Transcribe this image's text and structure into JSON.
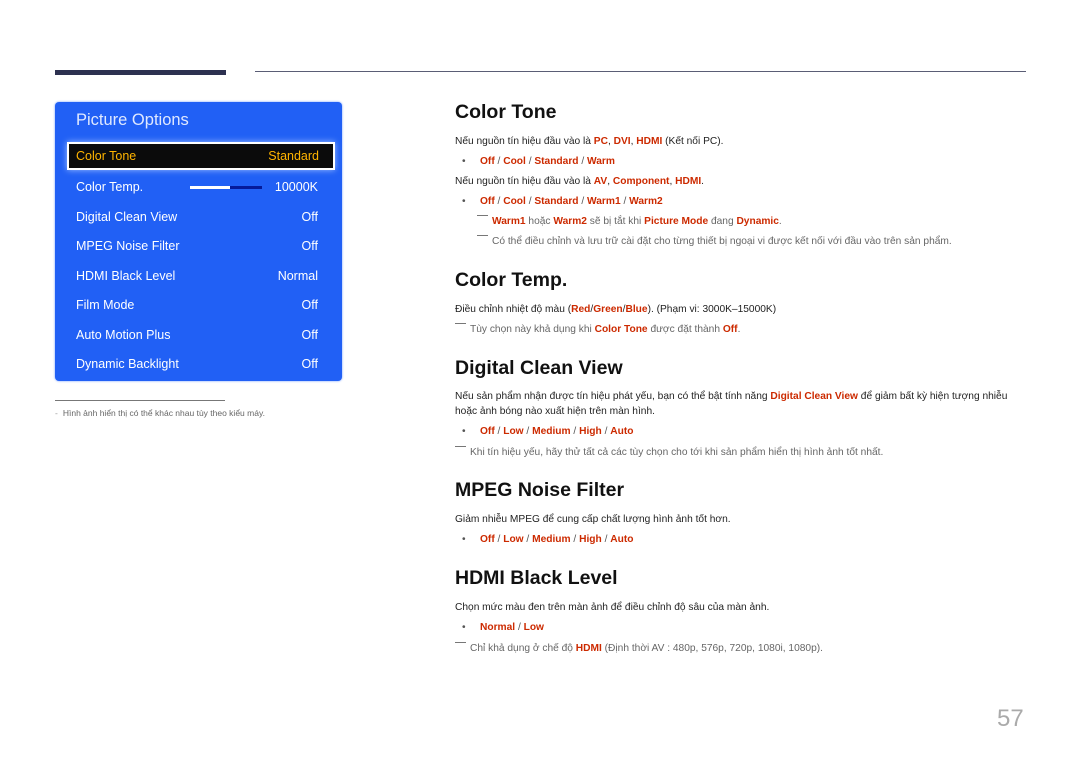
{
  "osd": {
    "title": "Picture Options",
    "items": [
      {
        "label": "Color Tone",
        "value": "Standard",
        "selected": true
      },
      {
        "label": "Color Temp.",
        "value": "10000K",
        "slider_fraction": 0.55
      },
      {
        "label": "Digital Clean View",
        "value": "Off"
      },
      {
        "label": "MPEG Noise Filter",
        "value": "Off"
      },
      {
        "label": "HDMI Black Level",
        "value": "Normal"
      },
      {
        "label": "Film Mode",
        "value": "Off"
      },
      {
        "label": "Auto Motion Plus",
        "value": "Off"
      },
      {
        "label": "Dynamic Backlight",
        "value": "Off"
      }
    ]
  },
  "footnote": {
    "dash": "-",
    "text": "Hình ảnh hiển thị có thể khác nhau tùy theo kiểu máy."
  },
  "sections": {
    "color_tone": {
      "title": "Color Tone",
      "p1": {
        "pre": "Nếu nguồn tín hiệu đầu vào là ",
        "a": "PC",
        "s1": ", ",
        "b": "DVI",
        "s2": ", ",
        "c": "HDMI",
        "post": " (Kết nối PC)."
      },
      "opts1": [
        "Off",
        "Cool",
        "Standard",
        "Warm"
      ],
      "p2": {
        "pre": "Nếu nguồn tín hiệu đầu vào là ",
        "a": "AV",
        "s1": ", ",
        "b": "Component",
        "s2": ", ",
        "c": "HDMI",
        "post": "."
      },
      "opts2": [
        "Off",
        "Cool",
        "Standard",
        "Warm1",
        "Warm2"
      ],
      "note1": {
        "a": "Warm1",
        "t1": " hoặc ",
        "b": "Warm2",
        "t2": " sẽ bị tắt khi ",
        "c": "Picture Mode",
        "t3": " đang ",
        "d": "Dynamic",
        "t4": "."
      },
      "note2": "Có thể điều chỉnh và lưu trữ cài đặt cho từng thiết bị ngoại vi được kết nối với đầu vào trên sản phẩm."
    },
    "color_temp": {
      "title": "Color Temp.",
      "p1": {
        "pre": "Điều chỉnh nhiệt độ màu (",
        "a": "Red",
        "s1": "/",
        "b": "Green",
        "s2": "/",
        "c": "Blue",
        "post": "). (Phạm vi: 3000K–15000K)"
      },
      "note1": {
        "t1": "Tùy chọn này khả dụng khi ",
        "a": "Color Tone",
        "t2": " được đặt thành ",
        "b": "Off",
        "t3": "."
      }
    },
    "digital_clean_view": {
      "title": "Digital Clean View",
      "p1": {
        "pre": "Nếu sản phẩm nhận được tín hiệu phát yếu, bạn có thể bật tính năng ",
        "a": "Digital Clean View",
        "post": " để giảm bất kỳ hiện tượng nhiễu hoặc ảnh bóng nào xuất hiện trên màn hình."
      },
      "opts": [
        "Off",
        "Low",
        "Medium",
        "High",
        "Auto"
      ],
      "note1": "Khi tín hiệu yếu, hãy thử tất cả các tùy chọn cho tới khi sản phẩm hiển thị hình ảnh tốt nhất."
    },
    "mpeg_noise_filter": {
      "title": "MPEG Noise Filter",
      "p1": "Giảm nhiễu MPEG để cung cấp chất lượng hình ảnh tốt hơn.",
      "opts": [
        "Off",
        "Low",
        "Medium",
        "High",
        "Auto"
      ]
    },
    "hdmi_black_level": {
      "title": "HDMI Black Level",
      "p1": "Chọn mức màu đen trên màn ảnh để điều chỉnh độ sâu của màn ảnh.",
      "opts": [
        "Normal",
        "Low"
      ],
      "note1": {
        "t1": "Chỉ khả dụng ở chế độ ",
        "a": "HDMI",
        "t2": " (Định thời AV : 480p, 576p, 720p, 1080i, 1080p)."
      }
    }
  },
  "page_number": "57",
  "bullet_char": "•",
  "separator": " / ",
  "colors": {
    "osd_blue": "#2160f5",
    "accent_red": "#cc2a00",
    "selected_text": "#ffb400"
  }
}
